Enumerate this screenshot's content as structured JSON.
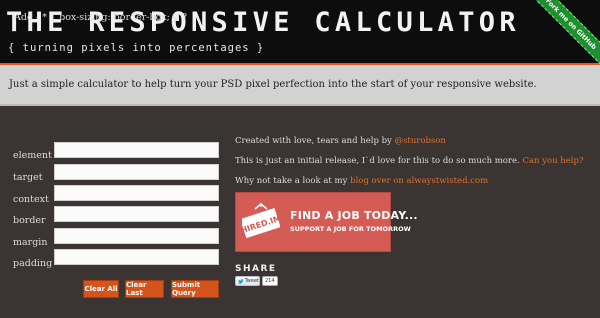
{
  "header": {
    "title": "THE RESPONSIVE CALCULATOR",
    "subtitle": "{ turning pixels into percentages }",
    "ribbon": "Fork me on GitHub",
    "accent_color": "#e05a1c",
    "ribbon_color": "#1e8f2c"
  },
  "intro": {
    "text": "Just a simple calculator to help turn your PSD pixel perfection into the start of your responsive website."
  },
  "form": {
    "add_label": "Add - * { box-sizing: border-box; } ?",
    "fields": [
      {
        "label": "element",
        "value": ""
      },
      {
        "label": "target",
        "value": ""
      },
      {
        "label": "context",
        "value": ""
      },
      {
        "label": "border",
        "value": ""
      },
      {
        "label": "margin",
        "value": ""
      },
      {
        "label": "padding",
        "value": ""
      }
    ],
    "buttons": {
      "clear_all": "Clear All",
      "clear_last": "Clear Last",
      "submit": "Submit Query"
    },
    "button_color": "#d5541b"
  },
  "info": {
    "line1_prefix": "Created with love, tears and help by ",
    "line1_link": "@sturobson",
    "line2_prefix": "This is just an initial release, I`d love for this to do so much more. ",
    "line2_link": "Can you help?",
    "line3_prefix": "Why not take a look at my ",
    "line3_link": "blog over on alwaystwisted.com",
    "link_color": "#e07030"
  },
  "banner": {
    "logo_text": "HIRED.IM",
    "line1": "FIND A JOB TODAY...",
    "line2": "SUPPORT A JOB FOR TOMORROW",
    "color": "#d55c55"
  },
  "share": {
    "title": "SHARE",
    "tweet_label": "Tweet",
    "tweet_count": "214"
  }
}
